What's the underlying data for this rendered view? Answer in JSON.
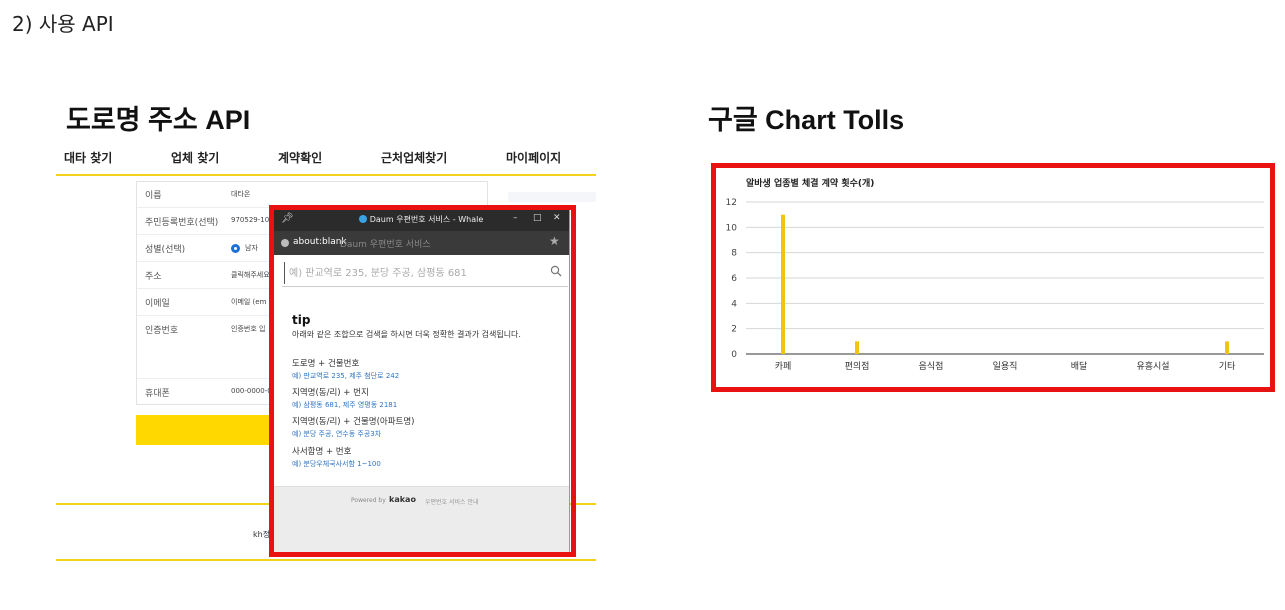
{
  "heading": "2)   사용 API",
  "left_section": {
    "title": "도로명 주소 API",
    "nav": [
      "대타 찾기",
      "업체 찾기",
      "계약확인",
      "근처업체찾기",
      "마이페이지"
    ],
    "form": {
      "name_label": "이름",
      "name_value": "대타온",
      "rrn_label": "주민등록번호(선택)",
      "rrn_value": "970529-100",
      "gender_label": "성별(선택)",
      "gender_value": "남자",
      "address_label": "주소",
      "address_value": "클릭해주세요",
      "email_label": "이메일",
      "email_value": "이메일 (em",
      "auth_label": "인증번호",
      "auth_value": "인증번호 입",
      "phone_label": "휴대폰",
      "phone_value": "000-0000-0"
    },
    "footer_text": "kh정",
    "popup": {
      "window_title": "Daum 우편번호 서비스 - Whale",
      "address_bar": "about:blank",
      "address_sub": "Daum 우편번호 서비스",
      "search_placeholder": "예) 판교역로 235, 분당 주공, 삼평동 681",
      "tip_title": "tip",
      "tip_desc": "아래와 같은 조합으로 검색을 하시면 더욱 정확한 결과가 검색됩니다.",
      "tips": [
        {
          "head": "도로명 + 건물번호",
          "example": "예) 판교역로 235,  제주 첨단로 242"
        },
        {
          "head": "지역명(동/리) + 번지",
          "example": "예) 삼평동 681,  제주 영평동 2181"
        },
        {
          "head": "지역명(동/리) + 건물명(아파트명)",
          "example": "예) 분당 주공,  연수동 주공3차"
        },
        {
          "head": "사서함명 + 번호",
          "example": "예) 분당우체국사서함 1~100"
        }
      ],
      "powered_by": "Powered by",
      "brand": "kakao",
      "guide": "우편번호 서비스 안내"
    }
  },
  "right_section": {
    "title": "구글 Chart Tolls"
  },
  "colors": {
    "highlight_red": "#ea1111",
    "brand_yellow": "#ffd800",
    "bar_yellow": "#f1c40f"
  },
  "chart_data": {
    "type": "bar",
    "title": "알바생 업종별 체결 계약 횟수(개)",
    "categories": [
      "카페",
      "편의점",
      "음식점",
      "일용직",
      "배달",
      "유흥시설",
      "기타"
    ],
    "values": [
      11,
      1,
      0,
      0,
      0,
      0,
      1
    ],
    "ylim": [
      0,
      12
    ],
    "yticks": [
      0,
      2,
      4,
      6,
      8,
      10,
      12
    ],
    "grid": true,
    "legend": "none"
  }
}
